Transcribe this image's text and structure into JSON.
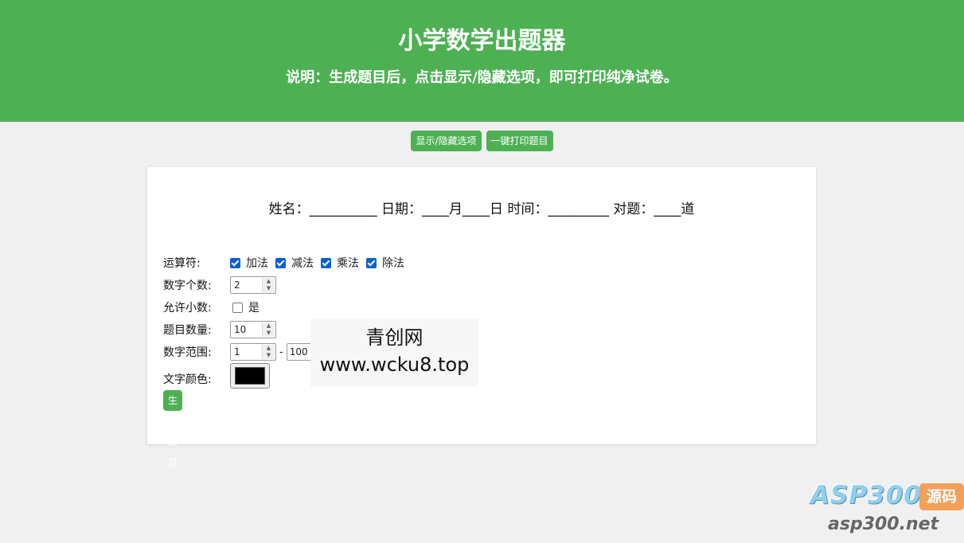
{
  "header": {
    "title": "小学数学出题器",
    "subtitle": "说明：生成题目后，点击显示/隐藏选项，即可打印纯净试卷。"
  },
  "toolbar": {
    "toggle_label": "显示/隐藏选项",
    "print_label": "一键打印题目"
  },
  "info_line": "姓名：__________ 日期：____月____日 时间：_________ 对题：____道",
  "form": {
    "operators_label": "运算符:",
    "operators": [
      {
        "label": "加法",
        "checked": true
      },
      {
        "label": "减法",
        "checked": true
      },
      {
        "label": "乘法",
        "checked": true
      },
      {
        "label": "除法",
        "checked": true
      }
    ],
    "digit_count_label": "数字个数:",
    "digit_count_value": "2",
    "decimals_label": "允许小数:",
    "decimals_option": "是",
    "decimals_checked": false,
    "question_count_label": "题目数量:",
    "question_count_value": "10",
    "range_label": "数字范围:",
    "range_min": "1",
    "range_sep": "-",
    "range_max": "100",
    "text_color_label": "文字颜色:",
    "text_color_value": "#000000",
    "generate_label": "生成题目"
  },
  "watermark": {
    "line1": "青创网",
    "line2": "www.wcku8.top"
  },
  "logo": {
    "brand": "ASP300",
    "badge": "源码",
    "url": "asp300.net"
  },
  "colors": {
    "accent": "#4db153",
    "checkbox": "#0b60d6",
    "background": "#f0f0f0"
  }
}
